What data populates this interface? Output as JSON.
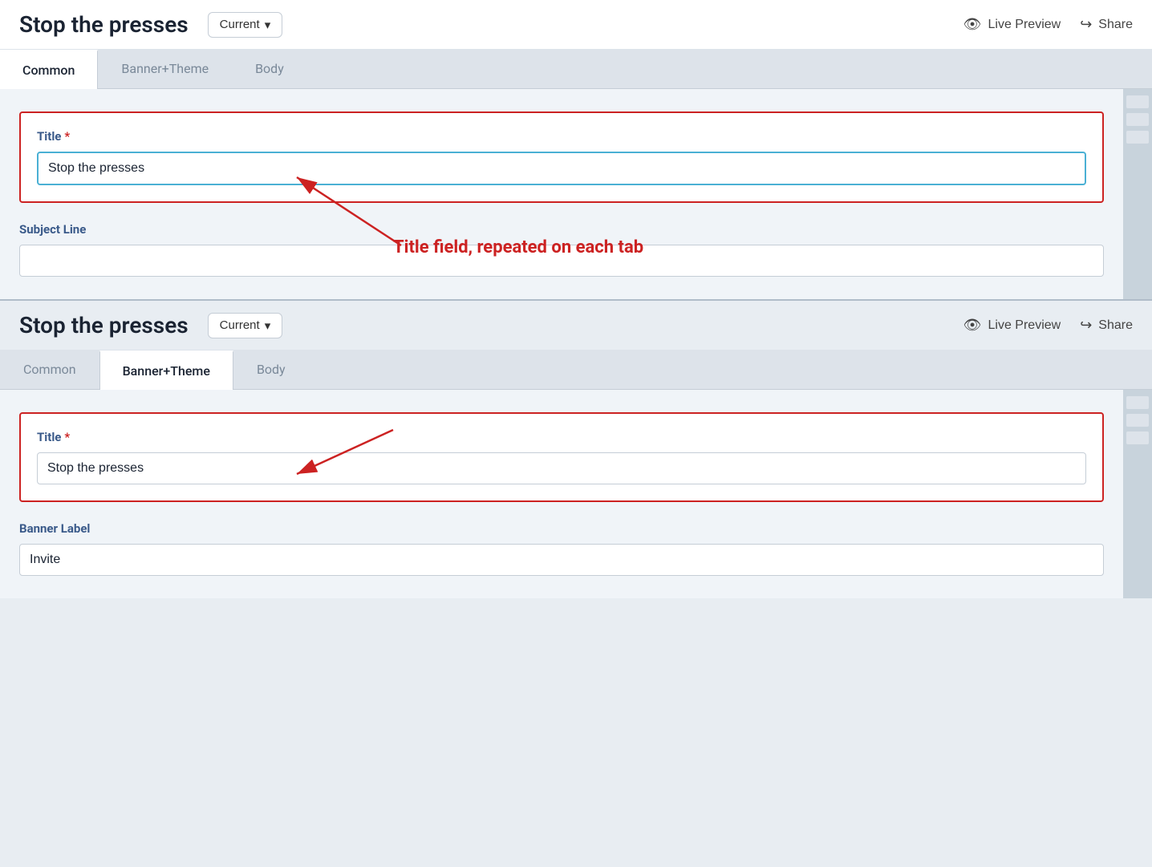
{
  "app": {
    "title": "Stop the presses"
  },
  "header": {
    "title": "Stop the presses",
    "version_label": "Current",
    "version_chevron": "▾",
    "live_preview_label": "Live Preview",
    "share_label": "Share"
  },
  "tabs": {
    "items": [
      {
        "id": "common",
        "label": "Common"
      },
      {
        "id": "banner_theme",
        "label": "Banner+Theme"
      },
      {
        "id": "body",
        "label": "Body"
      }
    ]
  },
  "panel1": {
    "active_tab": "common",
    "title_label": "Title",
    "title_value": "Stop the presses",
    "title_placeholder": "",
    "subject_label": "Subject Line",
    "subject_value": "",
    "subject_placeholder": ""
  },
  "panel2": {
    "active_tab": "banner_theme",
    "title_label": "Title",
    "title_value": "Stop the presses",
    "banner_label_label": "Banner Label",
    "banner_label_value": "Invite"
  },
  "annotation": {
    "text": "Title field, repeated on each tab"
  },
  "icons": {
    "eye": "👁",
    "share": "↪",
    "chevron_down": "∨"
  }
}
